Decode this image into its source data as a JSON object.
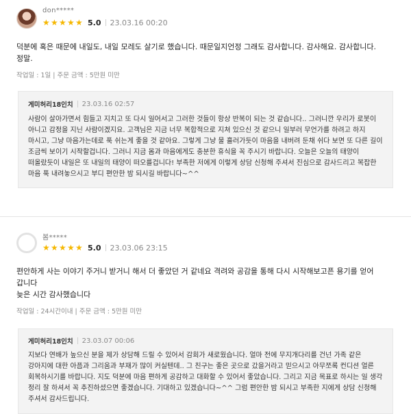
{
  "reviews": [
    {
      "user": "don*****",
      "rating": "5.0",
      "stars": "★★★★★",
      "date": "23.03.16 00:20",
      "text": "덕분에 혹은 때문에 내일도, 내일 모레도 살기로 했습니다. 때문일지언정 그래도 감사합니다. 감사해요. 감사합니다. 정말.",
      "purchase": "작업일 : 1일 | 주문 금액 : 5만원 미만",
      "reply": {
        "seller": "게미허리18인치",
        "date": "23.03.16 02:57",
        "text": "사람이 살아가면서 힘들고 지치고 또 다시 일어서고 그러한 것들이 항상 반복이 되는 것 같습니다.. 그러니깐 우리가 로봇이 아니고 감정을 지닌 사람이겠지요. 고객님은 지금 너무 복합적으로 지쳐 있으신 것 같으니 일부러 무언가를 하려고 하지 마시고, 그냥 마음가는데로 푹 쉬는게 좋을 것 같아요. 그렇게 그냥 물 흘러가듯이 마음을 내버려 둔채 쉬다 보면 또 다른 길이 조금씩 보이기 시작할겁니다. 그러니 지금 몸과 마음에게도 충분한 휴식을 꼭 주시기 바랍니다. 오늘은 오늘의 태양이 떠올랐듯이 내일은 또 내일의 태양이 떠오를겁니다! 부족한 저에게 이렇게 상담 신청해 주셔서 진심으로 감사드리고 복잡한 마음 푹 내려놓으시고 부디 편안한 밤 되시길 바랍니다~^^"
      }
    },
    {
      "user": "봄*****",
      "rating": "5.0",
      "stars": "★★★★★",
      "date": "23.03.06 23:15",
      "text": "편안하게 사는 이야기 주거니 받거니 해서 더 좋았던 거 같네요 격려와 공감을 통해 다시 시작해보고픈 용기를 얻어 갑니다\n늦은 시간 감사했습니다",
      "purchase": "작업일 : 24시간이내 | 주문 금액 : 5만원 미만",
      "reply": {
        "seller": "게미허리18인치",
        "date": "23.03.07 00:06",
        "text": "지보다 연배가 높으신 분을 제가 상담해 드릴 수 있어서 감회가 새로웠습니다. 얼마 전에 무지개다리를 건넌 가족 같은 강아지에 대한 아픔과 그리움과 부재가 많이 커실텐데.. 그 친구는 좋은 곳으로 갔을거라고 믿으시고 아무쪼록 컨디션 얼른 회복하시기를 바랍니다. 지도 덕분에 마음 편하게 공감하고 대화할 수 있어서 좋았습니다. 그리고 지금 목표로 하시는 일 생각 정리 잘 하셔서 꼭 추진하셨으면 좋겠습니다. 기대하고 있겠습니다~^^ 그럼 편안한 밤 되시고 부족한 지에게 상담 신청해 주셔서 감사드립니다."
      }
    }
  ],
  "colors": {
    "star": "#f5b700",
    "reply_bg": "#f3f3f3"
  }
}
